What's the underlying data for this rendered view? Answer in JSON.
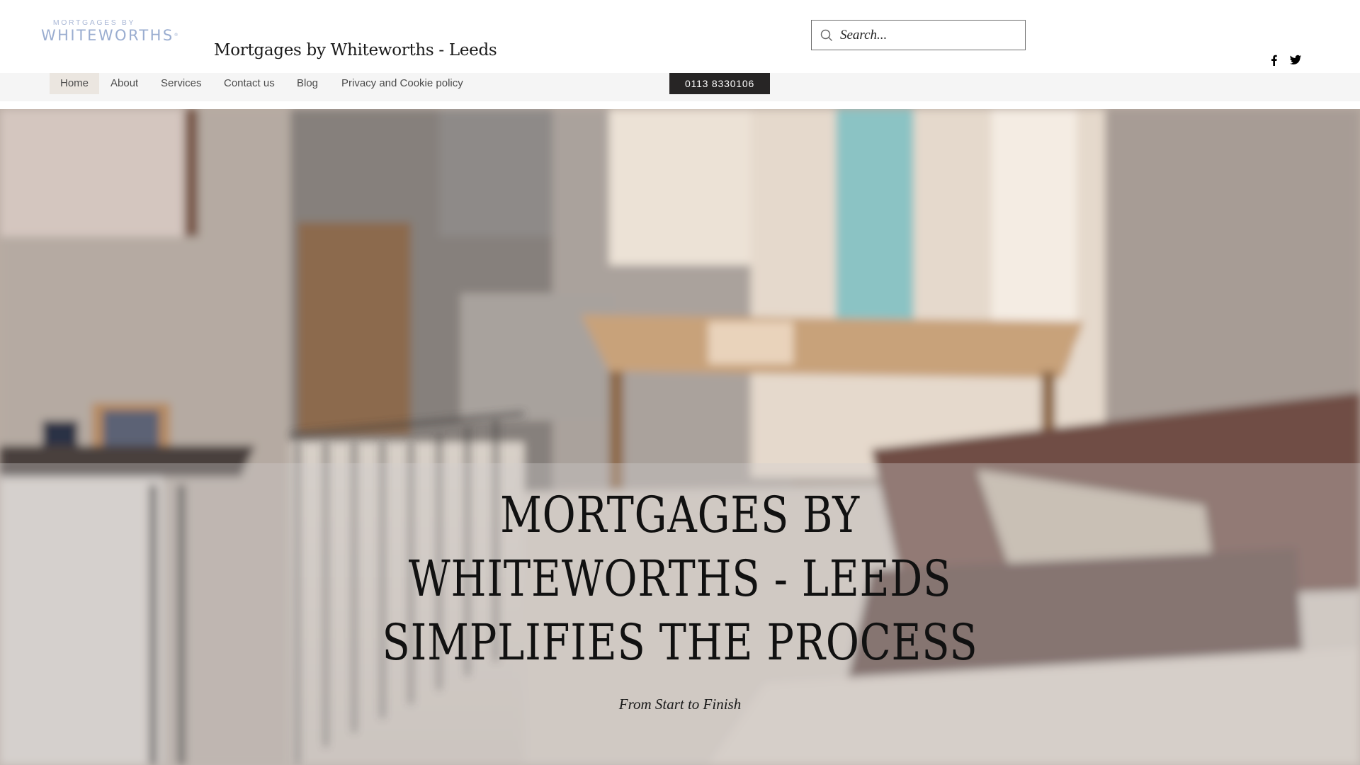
{
  "header": {
    "logo": {
      "line1": "MORTGAGES BY",
      "line2": "WHITEWORTHS",
      "trademark": "®",
      "brand_color": "#9aadd0"
    },
    "site_title": "Mortgages by Whiteworths - Leeds",
    "search": {
      "placeholder": "Search...",
      "value": "",
      "icon": "search-icon"
    },
    "social": [
      {
        "name": "Facebook",
        "icon": "facebook-icon"
      },
      {
        "name": "Twitter",
        "icon": "twitter-icon"
      }
    ]
  },
  "nav": {
    "items": [
      {
        "label": "Home",
        "active": true
      },
      {
        "label": "About",
        "active": false
      },
      {
        "label": "Services",
        "active": false
      },
      {
        "label": "Contact us",
        "active": false
      },
      {
        "label": "Blog",
        "active": false
      },
      {
        "label": "Privacy and Cookie policy",
        "active": false
      }
    ],
    "phone_button": "0113 8330106"
  },
  "hero": {
    "title_lines": [
      "MORTGAGES BY",
      "WHITEWORTHS - LEEDS",
      "SIMPLIFIES THE PROCESS"
    ],
    "subtitle": "From Start to Finish",
    "image": "kitchen-living-room-photo"
  }
}
